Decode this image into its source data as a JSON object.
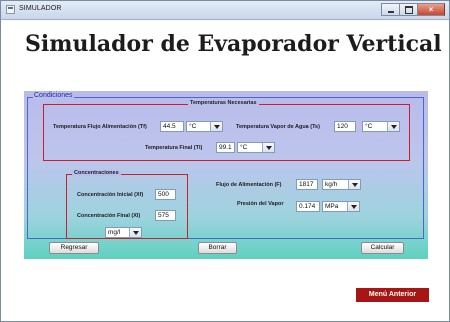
{
  "window": {
    "title": "SIMULADOR"
  },
  "heading": "Simulador de Evaporador Vertical",
  "conditions": {
    "legend": "Condiciones",
    "temperatures": {
      "legend": "Temperaturas Necesarias",
      "feed_temp_label": "Temperatura Flujo Alimentación (Tf)",
      "feed_temp_value": "44.5",
      "feed_temp_unit": "°C",
      "steam_temp_label": "Temperatura Vapor de Agua (Ts)",
      "steam_temp_value": "120",
      "steam_temp_unit": "°C",
      "final_temp_label": "Temperatura Final (Tl)",
      "final_temp_value": "99.1",
      "final_temp_unit": "°C"
    },
    "concentrations": {
      "legend": "Concentraciones",
      "initial_label": "Concentración Inicial (Xf)",
      "initial_value": "500",
      "final_label": "Concentración Final (Xl)",
      "final_value": "575",
      "unit": "mg/l"
    },
    "feed_flow_label": "Flujo de Alimentación (F)",
    "feed_flow_value": "1817",
    "feed_flow_unit": "kg/h",
    "steam_pressure_label": "Presión del Vapor",
    "steam_pressure_value": "0.174",
    "steam_pressure_unit": "MPa"
  },
  "buttons": {
    "back": "Regresar",
    "clear": "Borrar",
    "calculate": "Calcular",
    "previous_menu": "Menú Anterior"
  },
  "colors": {
    "accent_red": "#a81515",
    "panel_border": "#4b67c9",
    "group_border": "#cc1f2a"
  }
}
